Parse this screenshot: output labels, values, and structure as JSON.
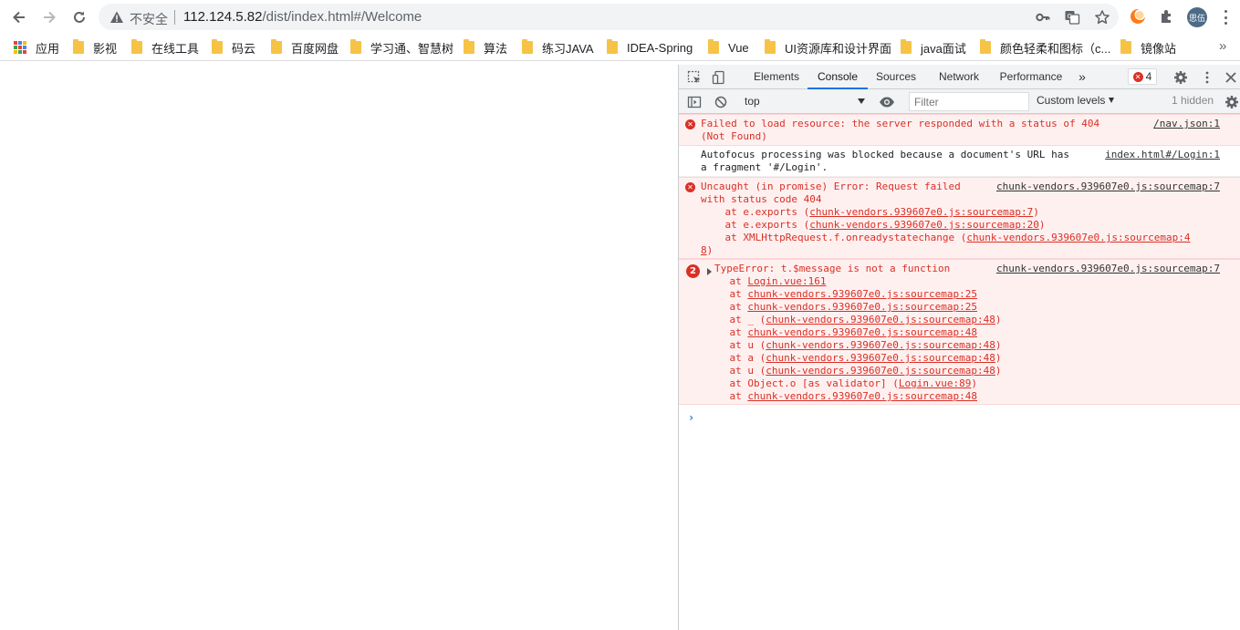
{
  "toolbar": {
    "insecure_label": "不安全",
    "url_host": "112.124.5.82",
    "url_path": "/dist/index.html#/Welcome",
    "profile_name": "思伍"
  },
  "bookmarks": {
    "apps_label": "应用",
    "items": [
      "影视",
      "在线工具",
      "码云",
      "百度网盘",
      "学习通、智慧树",
      "算法",
      "练习JAVA",
      "IDEA-Spring",
      "Vue",
      "UI资源库和设计界面",
      "java面试",
      "颜色轻柔和图标（c...",
      "镜像站"
    ],
    "more_label": "»"
  },
  "devtools": {
    "tabs": [
      "Elements",
      "Console",
      "Sources",
      "Network",
      "Performance"
    ],
    "more_tabs": "»",
    "error_count": "4",
    "context": "top",
    "filter_placeholder": "Filter",
    "levels_label": "Custom levels",
    "hidden_label": "1 hidden"
  },
  "console": {
    "msg1": {
      "line1": "Failed to load resource: the server responded with a status of 404",
      "line2": "(Not Found)",
      "source": "/nav.json:1"
    },
    "msg2": {
      "line1": "Autofocus processing was blocked because a document's URL has",
      "line2": "a fragment '#/Login'.",
      "source": "index.html#/Login:1"
    },
    "msg3": {
      "line1": "Uncaught (in promise) Error: Request failed",
      "line2": "with status code 404",
      "source": "chunk-vendors.939607e0.js:sourcemap:7",
      "stack": [
        {
          "prefix": "    at e.exports (",
          "link": "chunk-vendors.939607e0.js:sourcemap:7",
          "suffix": ")"
        },
        {
          "prefix": "    at e.exports (",
          "link": "chunk-vendors.939607e0.js:sourcemap:20",
          "suffix": ")"
        },
        {
          "prefix": "    at XMLHttpRequest.f.onreadystatechange (",
          "link": "chunk-vendors.939607e0.js:sourcemap:4",
          "suffix": ""
        }
      ],
      "wrap_link": "8",
      "wrap_suffix": ")"
    },
    "msg4": {
      "count": "2",
      "line1": "TypeError: t.$message is not a function",
      "source": "chunk-vendors.939607e0.js:sourcemap:7",
      "stack": [
        {
          "prefix": "    at ",
          "link": "Login.vue:161",
          "suffix": ""
        },
        {
          "prefix": "    at ",
          "link": "chunk-vendors.939607e0.js:sourcemap:25",
          "suffix": ""
        },
        {
          "prefix": "    at ",
          "link": "chunk-vendors.939607e0.js:sourcemap:25",
          "suffix": ""
        },
        {
          "prefix": "    at _ (",
          "link": "chunk-vendors.939607e0.js:sourcemap:48",
          "suffix": ")"
        },
        {
          "prefix": "    at ",
          "link": "chunk-vendors.939607e0.js:sourcemap:48",
          "suffix": ""
        },
        {
          "prefix": "    at u (",
          "link": "chunk-vendors.939607e0.js:sourcemap:48",
          "suffix": ")"
        },
        {
          "prefix": "    at a (",
          "link": "chunk-vendors.939607e0.js:sourcemap:48",
          "suffix": ")"
        },
        {
          "prefix": "    at u (",
          "link": "chunk-vendors.939607e0.js:sourcemap:48",
          "suffix": ")"
        },
        {
          "prefix": "    at Object.o [as validator] (",
          "link": "Login.vue:89",
          "suffix": ")"
        },
        {
          "prefix": "    at ",
          "link": "chunk-vendors.939607e0.js:sourcemap:48",
          "suffix": ""
        }
      ]
    },
    "prompt": "›"
  }
}
